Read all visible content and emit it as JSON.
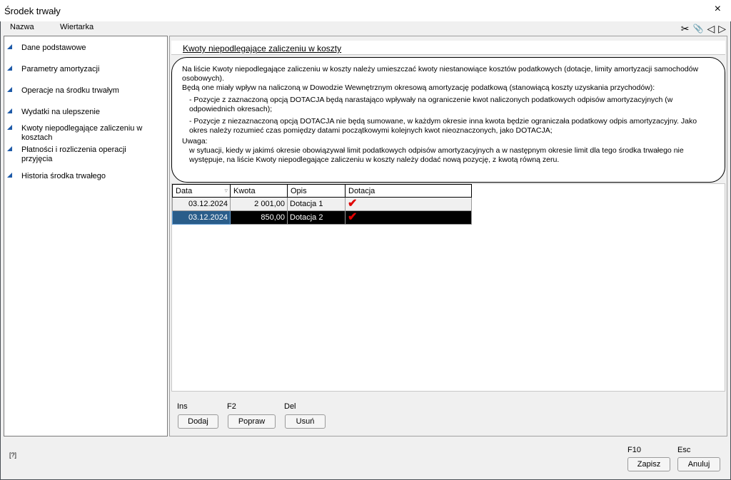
{
  "window": {
    "title": "Środek trwały",
    "close_icon": "×"
  },
  "menu": {
    "items": [
      "Nazwa",
      "Wiertarka"
    ]
  },
  "toolbar": {
    "icons": [
      {
        "name": "scissors-icon",
        "glyph": "✂"
      },
      {
        "name": "paperclip-icon",
        "glyph": "📎"
      },
      {
        "name": "prev-icon",
        "glyph": "◁"
      },
      {
        "name": "next-icon",
        "glyph": "▷"
      }
    ]
  },
  "sidebar": {
    "items": [
      "Dane podstawowe",
      "Parametry amortyzacji",
      "Operacje na środku trwałym",
      "Wydatki na ulepszenie",
      "Kwoty niepodlegające zaliczeniu w kosztach",
      "Płatności i rozliczenia operacji przyjęcia",
      "Historia środka trwałego"
    ]
  },
  "section": {
    "title": "Kwoty niepodlegające zaliczeniu w koszty",
    "info": {
      "p1": "Na liście Kwoty niepodlegające zaliczeniu w koszty należy umieszczać kwoty niestanowiące kosztów podatkowych (dotacje, limity amortyzacji samochodów osobowych).",
      "p2": "Będą one miały wpływ na naliczoną w Dowodzie Wewnętrznym okresową amortyzację podatkową (stanowiącą koszty uzyskania przychodów):",
      "p3": "- Pozycje z zaznaczoną opcją DOTACJA będą narastająco wpływały na ograniczenie kwot naliczonych podatkowych odpisów amortyzacyjnych (w odpowiednich okresach);",
      "p4": "- Pozycje z niezaznaczoną opcją DOTACJA nie będą sumowane, w każdym okresie inna kwota będzie ograniczała podatkowy odpis amortyzacyjny. Jako okres należy rozumieć czas pomiędzy datami początkowymi kolejnych kwot nieoznaczonych, jako DOTACJA;",
      "p5": "Uwaga:",
      "p6": "w sytuacji, kiedy w jakimś okresie obowiązywał limit podatkowych odpisów amortyzacyjnych a w następnym okresie limit dla tego środka trwałego nie występuje, na liście Kwoty niepodlegające zaliczeniu w koszty należy dodać nową pozycję, z kwotą równą zeru."
    }
  },
  "grid": {
    "headers": [
      "Data",
      "Kwota",
      "Opis",
      "Dotacja"
    ],
    "rows": [
      {
        "data": "03.12.2024",
        "kwota": "2 001,00",
        "opis": "Dotacja 1",
        "dotacja": "✔"
      },
      {
        "data": "03.12.2024",
        "kwota": "850,00",
        "opis": "Dotacja 2",
        "dotacja": "✔"
      }
    ]
  },
  "actions": {
    "add": {
      "key": "Ins",
      "label": "Dodaj"
    },
    "edit": {
      "key": "F2",
      "label": "Popraw"
    },
    "delete": {
      "key": "Del",
      "label": "Usuń"
    }
  },
  "footer": {
    "help": "[?]",
    "save": {
      "key": "F10",
      "label": "Zapisz"
    },
    "cancel": {
      "key": "Esc",
      "label": "Anuluj"
    }
  },
  "colors": {
    "accent": "#1e5aa8",
    "check": "#e00000",
    "selection": "#2a5d8a"
  }
}
